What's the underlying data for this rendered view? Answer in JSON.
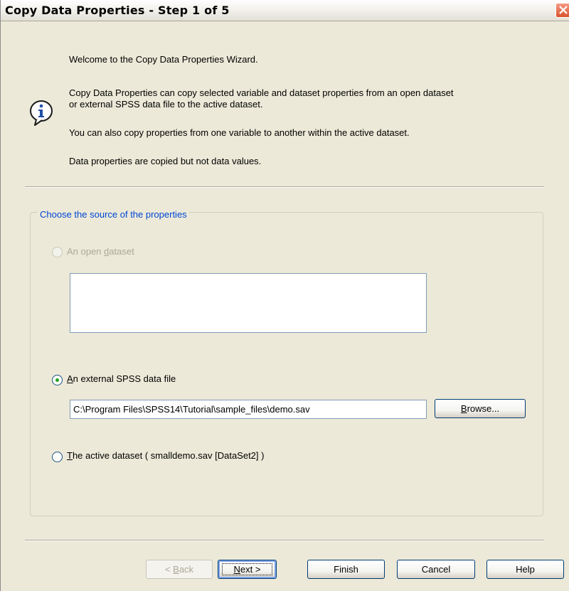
{
  "window": {
    "title": "Copy Data Properties - Step 1 of 5"
  },
  "intro": {
    "welcome": "Welcome to the Copy Data Properties Wizard.",
    "desc_line1": "Copy Data Properties can copy selected variable and dataset properties from an open dataset",
    "desc_line2": "or external SPSS data file to the active dataset.",
    "also": "You can also copy properties from one variable to another within the active dataset.",
    "note": "Data properties are copied but not data values.",
    "icon": "info-icon"
  },
  "source_group": {
    "legend": "Choose the source of the properties",
    "options": {
      "open_dataset": {
        "pre": "An open ",
        "mnemonic": "d",
        "post": "ataset",
        "selected": false,
        "enabled": false
      },
      "external_file": {
        "pre": "",
        "mnemonic": "A",
        "post": "n external SPSS data file",
        "selected": true,
        "enabled": true
      },
      "active_dataset": {
        "pre": "",
        "mnemonic": "T",
        "post": "he active dataset ( smalldemo.sav [DataSet2] )",
        "selected": false,
        "enabled": true
      }
    },
    "file_path": "C:\\Program Files\\SPSS14\\Tutorial\\sample_files\\demo.sav",
    "browse": {
      "mnemonic": "B",
      "post": "rowse..."
    }
  },
  "buttons": {
    "back": {
      "pre": "< ",
      "mnemonic": "B",
      "post": "ack",
      "enabled": false
    },
    "next": {
      "pre": "",
      "mnemonic": "N",
      "post": "ext >",
      "enabled": true
    },
    "finish": "Finish",
    "cancel": "Cancel",
    "help": "Help"
  },
  "colors": {
    "dialog_bg": "#ece9d8",
    "legend_text": "#0046d5",
    "radio_selected": "#21a121",
    "close_button": "#d9522b"
  }
}
